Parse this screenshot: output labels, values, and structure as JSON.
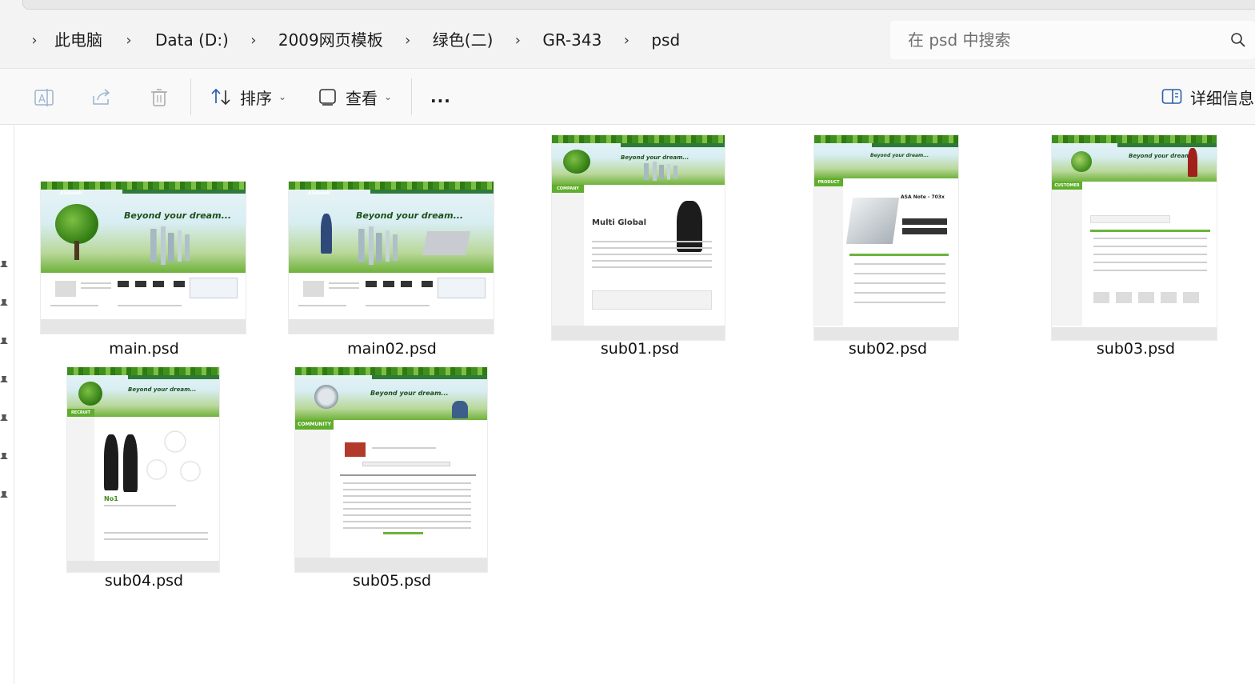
{
  "breadcrumb": {
    "items": [
      "此电脑",
      "Data (D:)",
      "2009网页模板",
      "绿色(二)",
      "GR-343",
      "psd"
    ]
  },
  "search": {
    "placeholder": "在 psd 中搜索"
  },
  "toolbar": {
    "sort_label": "排序",
    "view_label": "查看",
    "more_label": "...",
    "details_label": "详细信息"
  },
  "files": [
    {
      "name": "main.psd"
    },
    {
      "name": "main02.psd"
    },
    {
      "name": "sub01.psd"
    },
    {
      "name": "sub02.psd"
    },
    {
      "name": "sub03.psd"
    },
    {
      "name": "sub04.psd"
    },
    {
      "name": "sub05.psd"
    }
  ],
  "thumbnails": {
    "headline": "Beyond your dream...",
    "brand": "ASAweb",
    "section_company": "COMPANY",
    "section_product": "PRODUCT",
    "section_customer": "CUSTOMER",
    "section_recruit": "RECRUIT",
    "section_community": "COMMUNITY",
    "sub01_promo": "Multi Global",
    "sub02_promo": "ASA Note - 703x",
    "sub04_promo": "No1"
  },
  "colors": {
    "accent_green": "#5fae2c",
    "toolbar_bg": "#f9f9f9",
    "address_bg": "#f3f3f3"
  }
}
